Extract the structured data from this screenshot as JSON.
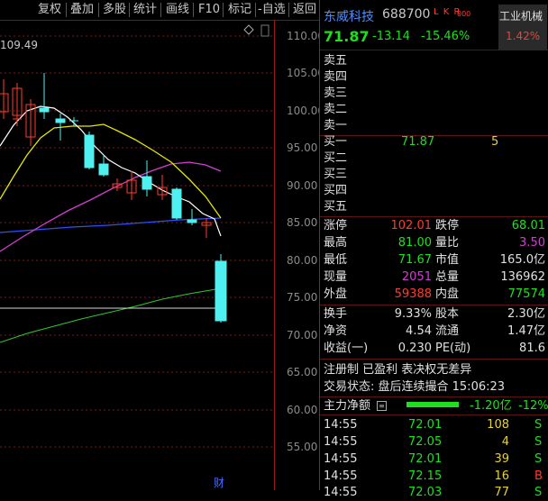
{
  "toolbar": {
    "buttons": [
      "复权",
      "叠加",
      "多股",
      "统计",
      "画线",
      "F10",
      "标记",
      "-自选",
      "返回"
    ]
  },
  "chart": {
    "max_label": "109.49",
    "y_ticks": [
      "110.00",
      "105.00",
      "100.00",
      "95.00",
      "90.00",
      "85.00",
      "80.00",
      "75.00",
      "70.00",
      "65.00",
      "60.00",
      "55.00"
    ],
    "finance_marker": "财",
    "settings_icon": "diamond-icon"
  },
  "stock": {
    "name": "东威科技",
    "code": "688700",
    "tags": "L K R",
    "tags_suffix": "000",
    "industry": "工业机械",
    "industry_change": "1.42%",
    "price": "71.87",
    "change": "-13.14",
    "change_pct": "-15.46%"
  },
  "order_book": {
    "sells": [
      {
        "label": "卖五",
        "price": "",
        "volume": ""
      },
      {
        "label": "卖四",
        "price": "",
        "volume": ""
      },
      {
        "label": "卖三",
        "price": "",
        "volume": ""
      },
      {
        "label": "卖二",
        "price": "",
        "volume": ""
      },
      {
        "label": "卖一",
        "price": "",
        "volume": ""
      }
    ],
    "buys": [
      {
        "label": "买一",
        "price": "71.87",
        "volume": "5"
      },
      {
        "label": "买二",
        "price": "",
        "volume": ""
      },
      {
        "label": "买三",
        "price": "",
        "volume": ""
      },
      {
        "label": "买四",
        "price": "",
        "volume": ""
      },
      {
        "label": "买五",
        "price": "",
        "volume": ""
      }
    ]
  },
  "quote": {
    "limit_up_label": "涨停",
    "limit_up": "102.01",
    "limit_down_label": "跌停",
    "limit_down": "68.01",
    "high_label": "最高",
    "high": "81.00",
    "vol_ratio_label": "量比",
    "vol_ratio": "3.50",
    "low_label": "最低",
    "low": "71.67",
    "mcap_label": "市值",
    "mcap": "165.0亿",
    "cur_vol_label": "现量",
    "cur_vol": "2051",
    "total_vol_label": "总量",
    "total_vol": "136962",
    "outer_label": "外盘",
    "outer": "59388",
    "inner_label": "内盘",
    "inner": "77574"
  },
  "fundamentals": {
    "turnover_label": "换手",
    "turnover": "9.33%",
    "equity_label": "股本",
    "equity": "2.30亿",
    "nav_label": "净资",
    "nav": "4.54",
    "float_label": "流通",
    "float": "1.47亿",
    "eps_label": "收益(一)",
    "eps": "0.230",
    "pe_label": "PE(动)",
    "pe": "81.6"
  },
  "info": {
    "line1": "注册制 已盈利 表决权无差异",
    "line2": "交易状态: 盘后连续撮合 15:06:23"
  },
  "flow": {
    "label": "主力净额",
    "value": "-1.20亿",
    "pct": "-12%"
  },
  "ticks": [
    {
      "time": "14:55",
      "price": "72.01",
      "vol": "108",
      "side": "S"
    },
    {
      "time": "14:55",
      "price": "72.05",
      "vol": "4",
      "side": "S"
    },
    {
      "time": "14:55",
      "price": "72.01",
      "vol": "39",
      "side": "S"
    },
    {
      "time": "14:55",
      "price": "72.15",
      "vol": "16",
      "side": "B"
    },
    {
      "time": "14:55",
      "price": "72.03",
      "vol": "77",
      "side": "S"
    }
  ],
  "colors": {
    "up": "#ff3b30",
    "down": "#1ee01e",
    "down_candle": "#4ff0f0",
    "ma5": "#ffffff",
    "ma10": "#e6e600",
    "ma20": "#d040d0",
    "ma60": "#3050ff",
    "ma120": "#2ec82e"
  }
}
